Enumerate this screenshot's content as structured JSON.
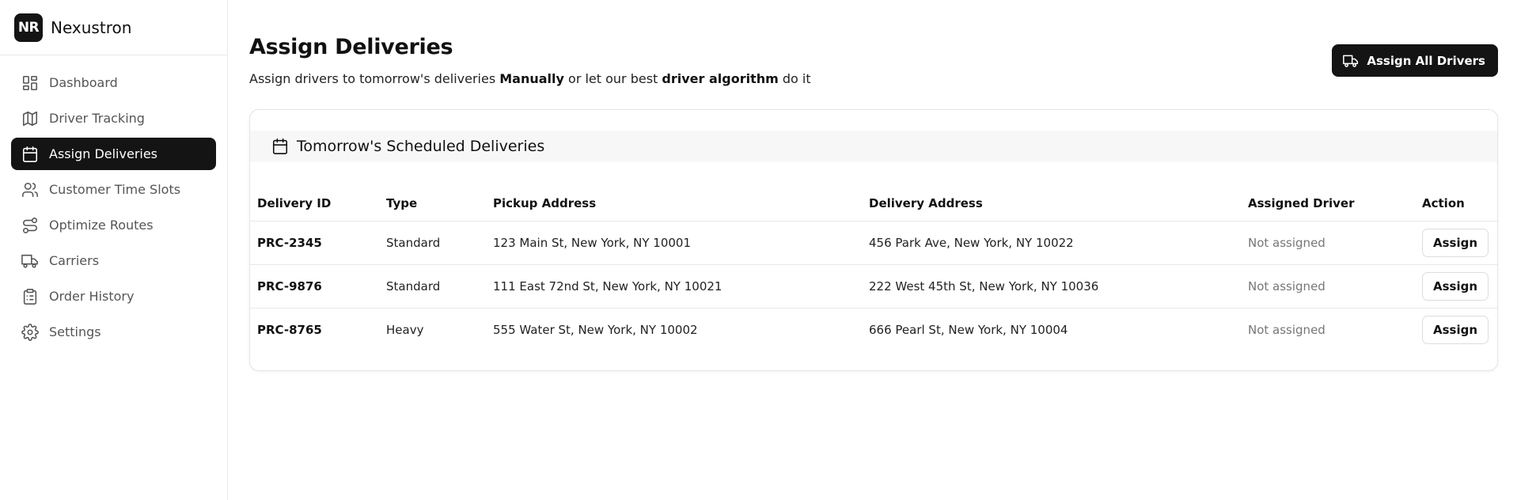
{
  "brand": {
    "logo_text": "NR",
    "name": "Nexustron"
  },
  "sidebar": {
    "items": [
      {
        "label": "Dashboard",
        "icon": "layout-dashboard-icon",
        "active": false
      },
      {
        "label": "Driver Tracking",
        "icon": "map-icon",
        "active": false
      },
      {
        "label": "Assign Deliveries",
        "icon": "calendar-icon",
        "active": true
      },
      {
        "label": "Customer Time Slots",
        "icon": "users-icon",
        "active": false
      },
      {
        "label": "Optimize Routes",
        "icon": "route-icon",
        "active": false
      },
      {
        "label": "Carriers",
        "icon": "truck-icon",
        "active": false
      },
      {
        "label": "Order History",
        "icon": "clipboard-list-icon",
        "active": false
      },
      {
        "label": "Settings",
        "icon": "gear-icon",
        "active": false
      }
    ]
  },
  "header": {
    "title": "Assign Deliveries",
    "subtitle": {
      "part1": "Assign drivers to tomorrow's deliveries ",
      "bold1": "Manually",
      "part2": " or let our best ",
      "bold2": "driver algorithm",
      "part3": " do it"
    },
    "assign_all_label": "Assign All Drivers"
  },
  "deliveries": {
    "title": "Tomorrow's Scheduled Deliveries",
    "columns": [
      "Delivery ID",
      "Type",
      "Pickup Address",
      "Delivery Address",
      "Assigned Driver",
      "Action"
    ],
    "rows": [
      {
        "id": "PRC-2345",
        "type": "Standard",
        "pickup": "123 Main St, New York, NY 10001",
        "delivery": "456 Park Ave, New York, NY 10022",
        "driver": "Not assigned",
        "action": "Assign"
      },
      {
        "id": "PRC-9876",
        "type": "Standard",
        "pickup": "111 East 72nd St, New York, NY 10021",
        "delivery": "222 West 45th St, New York, NY 10036",
        "driver": "Not assigned",
        "action": "Assign"
      },
      {
        "id": "PRC-8765",
        "type": "Heavy",
        "pickup": "555 Water St, New York, NY 10002",
        "delivery": "666 Pearl St, New York, NY 10004",
        "driver": "Not assigned",
        "action": "Assign"
      }
    ]
  },
  "colors": {
    "primary": "#141414",
    "muted_text": "#777777",
    "border": "#e8e8e8",
    "header_bg": "#f7f7f7"
  }
}
